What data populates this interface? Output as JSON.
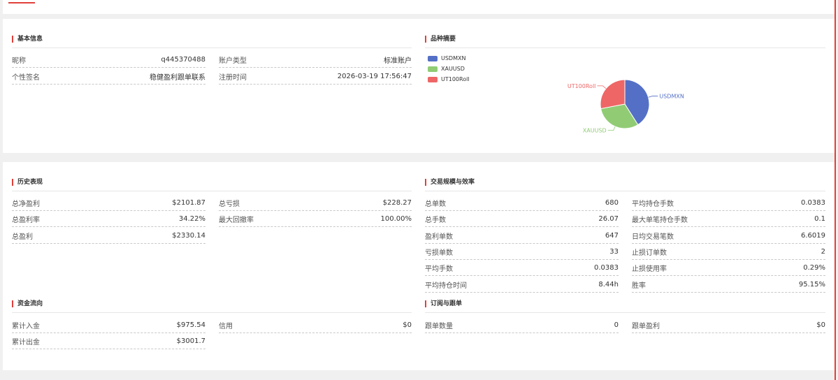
{
  "colors": {
    "accent": "#e0403a",
    "usdmxn": "#5470c6",
    "xauusd": "#91cc75",
    "ut100roll": "#ee6666"
  },
  "basic_info": {
    "title": "基本信息",
    "nickname_label": "昵称",
    "nickname_value": "q445370488",
    "account_type_label": "账户类型",
    "account_type_value": "标准账户",
    "signature_label": "个性签名",
    "signature_value": "稳健盈利跟单联系",
    "register_label": "注册时间",
    "register_value": "2026-03-19 17:56:47"
  },
  "symbol_summary": {
    "title": "品种摘要",
    "legend": [
      "USDMXN",
      "XAUUSD",
      "UT100Roll"
    ]
  },
  "chart_data": {
    "type": "pie",
    "categories": [
      "USDMXN",
      "XAUUSD",
      "UT100Roll"
    ],
    "values": [
      41,
      31,
      28
    ],
    "legend_position": "top-left"
  },
  "history": {
    "title": "历史表现",
    "net_profit_label": "总净盈利",
    "net_profit_value": "$2101.87",
    "total_loss_label": "总亏损",
    "total_loss_value": "$228.27",
    "profit_rate_label": "总盈利率",
    "profit_rate_value": "34.22%",
    "max_drawdown_label": "最大回撤率",
    "max_drawdown_value": "100.00%",
    "gross_profit_label": "总盈利",
    "gross_profit_value": "$2330.14"
  },
  "trading": {
    "title": "交易规模与效率",
    "total_orders_label": "总单数",
    "total_orders_value": "680",
    "avg_hold_lots_label": "平均持仓手数",
    "avg_hold_lots_value": "0.0383",
    "total_lots_label": "总手数",
    "total_lots_value": "26.07",
    "max_single_lots_label": "最大单笔持仓手数",
    "max_single_lots_value": "0.1",
    "profit_orders_label": "盈利单数",
    "profit_orders_value": "647",
    "daily_trades_label": "日均交易笔数",
    "daily_trades_value": "6.6019",
    "loss_orders_label": "亏损单数",
    "loss_orders_value": "33",
    "stop_loss_orders_label": "止损订单数",
    "stop_loss_orders_value": "2",
    "avg_lots_label": "平均手数",
    "avg_lots_value": "0.0383",
    "stop_loss_rate_label": "止损使用率",
    "stop_loss_rate_value": "0.29%",
    "avg_hold_time_label": "平均持仓时间",
    "avg_hold_time_value": "8.44h",
    "win_rate_label": "胜率",
    "win_rate_value": "95.15%"
  },
  "funds": {
    "title": "资金流向",
    "deposit_label": "累计入金",
    "deposit_value": "$975.54",
    "credit_label": "信用",
    "credit_value": "$0",
    "withdraw_label": "累计出金",
    "withdraw_value": "$3001.7"
  },
  "subscribe": {
    "title": "订阅与跟单",
    "copy_count_label": "跟单数量",
    "copy_count_value": "0",
    "copy_profit_label": "跟单盈利",
    "copy_profit_value": "$0"
  }
}
